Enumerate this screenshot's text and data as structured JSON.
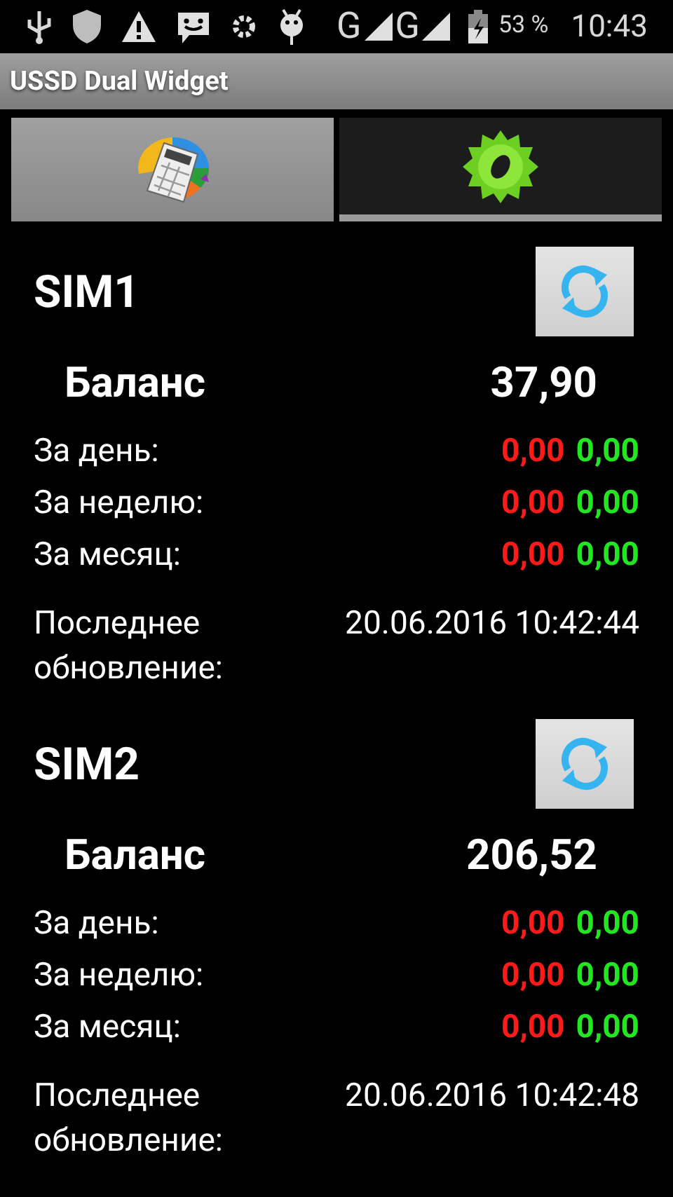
{
  "status_bar": {
    "battery": "53 %",
    "time": "10:43",
    "network_1": "G",
    "network_2": "G"
  },
  "title_bar": {
    "title": "USSD Dual Widget"
  },
  "tabs": [
    {
      "kind": "calculator",
      "selected": true
    },
    {
      "kind": "settings",
      "selected": false
    }
  ],
  "sims": [
    {
      "name": "SIM1",
      "balance_label": "Баланс",
      "balance": "37,90",
      "rows": [
        {
          "label": "За день:",
          "spent": "0,00",
          "added": "0,00"
        },
        {
          "label": "За неделю:",
          "spent": "0,00",
          "added": "0,00"
        },
        {
          "label": "За месяц:",
          "spent": "0,00",
          "added": "0,00"
        }
      ],
      "updated_label": "Последнее обновление:",
      "updated": "20.06.2016 10:42:44"
    },
    {
      "name": "SIM2",
      "balance_label": "Баланс",
      "balance": "206,52",
      "rows": [
        {
          "label": "За день:",
          "spent": "0,00",
          "added": "0,00"
        },
        {
          "label": "За неделю:",
          "spent": "0,00",
          "added": "0,00"
        },
        {
          "label": "За месяц:",
          "spent": "0,00",
          "added": "0,00"
        }
      ],
      "updated_label": "Последнее обновление:",
      "updated": "20.06.2016 10:42:48"
    }
  ]
}
